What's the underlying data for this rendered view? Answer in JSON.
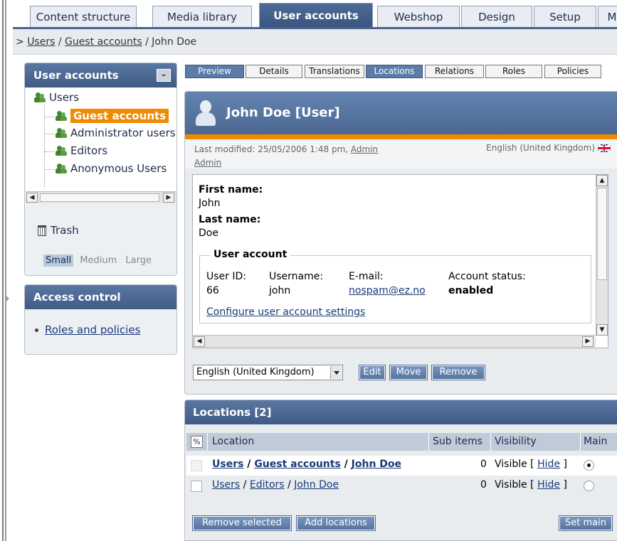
{
  "top_tabs": [
    {
      "label": "Content structure"
    },
    {
      "label": "Media library"
    },
    {
      "label": "User accounts"
    },
    {
      "label": "Webshop"
    },
    {
      "label": "Design"
    },
    {
      "label": "Setup"
    },
    {
      "label": "M"
    }
  ],
  "breadcrumb": {
    "prefix": ">",
    "items": [
      "Users",
      "Guest accounts"
    ],
    "current": "John Doe",
    "sep": "/"
  },
  "left_box": {
    "title": "User accounts",
    "collapse_label": "–",
    "tree": {
      "root": "Users",
      "children": [
        "Guest accounts",
        "Administrator users",
        "Editors",
        "Anonymous Users"
      ]
    },
    "trash_label": "Trash",
    "sizes": [
      "Small",
      "Medium",
      "Large"
    ]
  },
  "access_box": {
    "title": "Access control",
    "link": "Roles and policies"
  },
  "sub_tabs": [
    "Preview",
    "Details",
    "Translations",
    "Locations",
    "Relations",
    "Roles",
    "Policies"
  ],
  "object": {
    "title": "John Doe [User]",
    "last_modified_prefix": "Last modified: 25/05/2006 1:48 pm, ",
    "modifier_first": "Admin",
    "modifier_second": "Admin",
    "language": "English (United Kingdom)",
    "fields": {
      "first_name_label": "First name:",
      "first_name": "John",
      "last_name_label": "Last name:",
      "last_name": "Doe"
    },
    "user_account": {
      "legend": "User account",
      "user_id_label": "User ID:",
      "user_id": "66",
      "username_label": "Username:",
      "username": "john",
      "email_label": "E-mail:",
      "email": "nospam@ez.no",
      "status_label": "Account status:",
      "status": "enabled",
      "configure_link": "Configure user account settings"
    }
  },
  "actions": {
    "language_select": "English (United Kingdom)",
    "edit": "Edit",
    "move": "Move",
    "remove": "Remove"
  },
  "locations": {
    "title": "Locations [2]",
    "toggle_glyph": "%",
    "columns": [
      "Location",
      "Sub items",
      "Visibility",
      "Main"
    ],
    "rows": [
      {
        "path": [
          "Users",
          "Guest accounts",
          "John Doe"
        ],
        "sub_items": "0",
        "visibility": "Visible",
        "hide": "Hide",
        "main": true
      },
      {
        "path": [
          "Users",
          "Editors",
          "John Doe"
        ],
        "sub_items": "0",
        "visibility": "Visible",
        "hide": "Hide",
        "main": false
      }
    ],
    "remove_selected": "Remove selected",
    "add_locations": "Add locations",
    "set_main": "Set main"
  }
}
